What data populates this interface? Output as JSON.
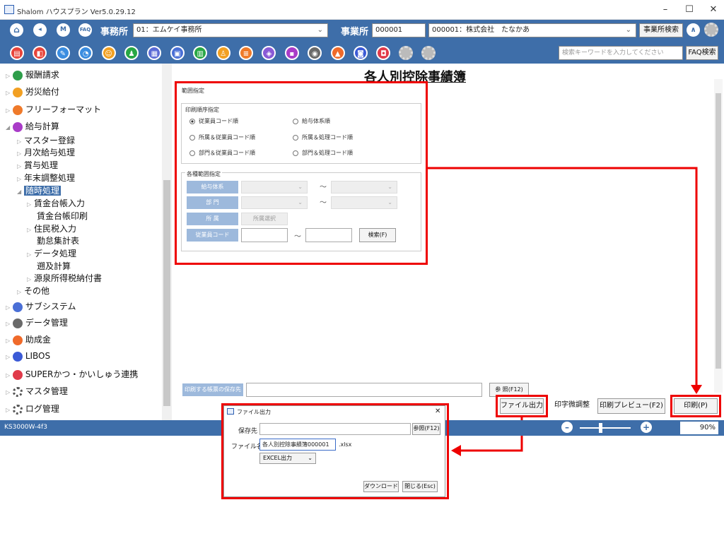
{
  "window": {
    "title": "Shalom ハウスプラン Ver5.0.29.12",
    "minimize": "–",
    "maximize": "☐",
    "close": "✕"
  },
  "toolbar": {
    "home_label": "⌂",
    "back_label": "◂",
    "m_label": "M",
    "faq_label": "FAQ",
    "office_label": "事務所",
    "office_value": "01：エムケイ事務所",
    "office_caret": "⌄",
    "business_label": "事業所",
    "business_code": "000001",
    "business_value": "000001：株式会社　たなかあ",
    "business_caret": "⌄",
    "business_search_button": "事業所検索",
    "up_label": "∧",
    "search_placeholder": "検索キーワードを入力してください",
    "faq_search_button": "FAQ検索",
    "function_icons": [
      {
        "name": "document-icon",
        "color": "#e8443a",
        "glyph": "▤"
      },
      {
        "name": "report-icon",
        "color": "#e8443a",
        "glyph": "◧"
      },
      {
        "name": "pen-icon",
        "color": "#3b8de0",
        "glyph": "✎"
      },
      {
        "name": "chart-icon",
        "color": "#3b8de0",
        "glyph": "◔"
      },
      {
        "name": "people-icon",
        "color": "#f2a022",
        "glyph": "☺"
      },
      {
        "name": "user-icon",
        "color": "#28a745",
        "glyph": "♟"
      },
      {
        "name": "calendar-icon",
        "color": "#5b6bd6",
        "glyph": "▦"
      },
      {
        "name": "card-icon",
        "color": "#4a6fd6",
        "glyph": "▣"
      },
      {
        "name": "sheet-icon",
        "color": "#28a745",
        "glyph": "▥"
      },
      {
        "name": "person-icon",
        "color": "#f2a022",
        "glyph": "♙"
      },
      {
        "name": "list-icon",
        "color": "#ef7a2a",
        "glyph": "≡"
      },
      {
        "name": "tag-icon",
        "color": "#8a5ad6",
        "glyph": "◈"
      },
      {
        "name": "app-icon",
        "color": "#a93cc8",
        "glyph": "▪"
      },
      {
        "name": "camera-icon",
        "color": "#6a6a6a",
        "glyph": "◉"
      },
      {
        "name": "house-icon",
        "color": "#f06a2a",
        "glyph": "▲"
      },
      {
        "name": "book-icon",
        "color": "#3b5ad6",
        "glyph": "◙"
      },
      {
        "name": "bookmark-icon",
        "color": "#e03a4a",
        "glyph": "◘"
      }
    ]
  },
  "sidebar": {
    "items": [
      {
        "label": "報酬請求",
        "color": "#2e9e4a"
      },
      {
        "label": "労災給付",
        "color": "#f2a022"
      },
      {
        "label": "フリーフォーマット",
        "color": "#ef7a2a"
      },
      {
        "label": "給与計算",
        "color": "#a93cc8"
      }
    ],
    "sub_items": [
      "マスター登録",
      "月次給与処理",
      "賞与処理",
      "年末調整処理"
    ],
    "selected": "随時処理",
    "leaf_items": [
      "賃金台帳入力",
      "賃金台帳印刷",
      "住民税入力",
      "勤怠集計表",
      "データ処理",
      "遡及計算",
      "源泉所得税納付書"
    ],
    "other": "その他",
    "bottom_items": [
      {
        "label": "サブシステム",
        "color": "#4a6fd6"
      },
      {
        "label": "データ管理",
        "color": "#6a6a6a"
      },
      {
        "label": "助成金",
        "color": "#f06a2a"
      },
      {
        "label": "LIBOS",
        "color": "#3b5ad6"
      },
      {
        "label": "SUPERかつ・かいしゅう連携",
        "color": "#e03a4a"
      },
      {
        "label": "マスタ管理",
        "color": "#888888"
      },
      {
        "label": "ログ管理",
        "color": "#888888"
      }
    ]
  },
  "main": {
    "title": "各人別控除事績簿",
    "range_caption": "範囲指定",
    "print_order": {
      "caption": "印刷順序指定",
      "options": [
        "従業員コード順",
        "給与体系順",
        "所属＆従業員コード順",
        "所属＆処理コード順",
        "部門＆従業員コード順",
        "部門＆処理コード順"
      ],
      "selected_index": 0
    },
    "range": {
      "caption": "各種範囲指定",
      "salary_label": "給与体系",
      "dept_label": "部 門",
      "affil_label": "所 属",
      "affil_select_button": "所属選択",
      "emp_label": "従業員コード",
      "tilde": "～",
      "search_button": "検索(F)"
    },
    "save_label": "印刷する帳票の保存先",
    "browse_button": "参 照(F12)",
    "file_output_button": "ファイル出力",
    "char_adjust_button": "印字微調整",
    "preview_button": "印刷プレビュー(F2)",
    "print_button": "印刷(P)"
  },
  "status": {
    "code": "KS3000W-4f3",
    "zoom": "90%",
    "minus": "–",
    "plus": "+"
  },
  "dialog": {
    "title": "ファイル出力",
    "close": "✕",
    "save_label": "保存先",
    "browse_button": "参照(F12)",
    "filename_label": "ファイル名",
    "filename_value": "各人別控除事績簿000001",
    "ext": ".xlsx",
    "format_value": "EXCEL出力",
    "format_caret": "⌄",
    "download_button": "ダウンロード",
    "close_button": "閉じる(Esc)"
  }
}
